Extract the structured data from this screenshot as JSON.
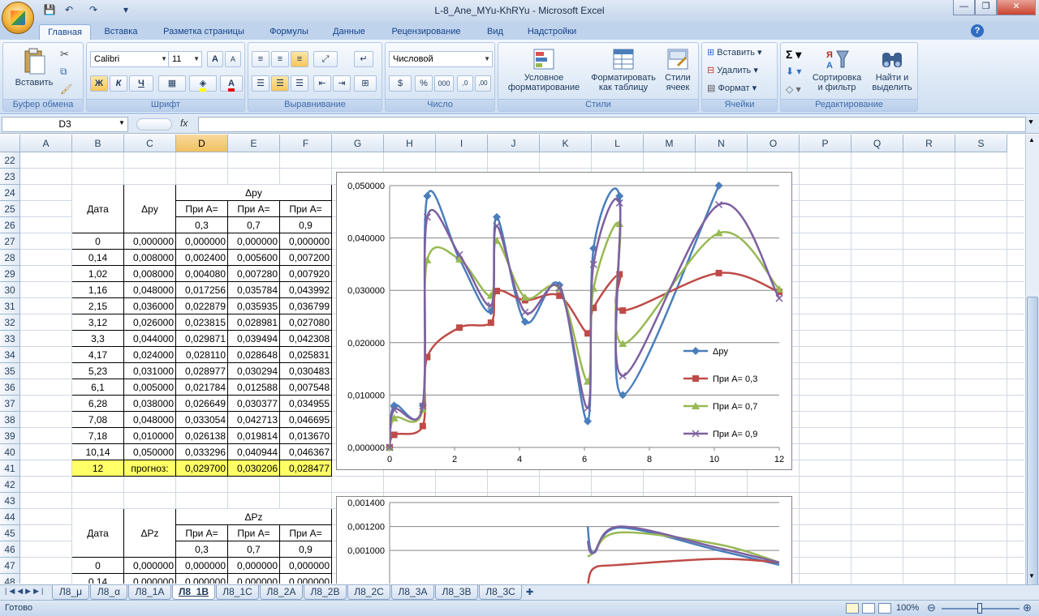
{
  "app": {
    "title": "L-8_Ane_MYu-KhRYu - Microsoft Excel",
    "minimize": "—",
    "restore": "❐",
    "close": "✕",
    "help": "?"
  },
  "quick_access": {
    "save": "💾",
    "undo": "↶",
    "redo": "↷",
    "customize": "▾"
  },
  "tabs": [
    "Главная",
    "Вставка",
    "Разметка страницы",
    "Формулы",
    "Данные",
    "Рецензирование",
    "Вид",
    "Надстройки"
  ],
  "ribbon": {
    "clipboard": {
      "label": "Буфер обмена",
      "paste": "Вставить"
    },
    "font": {
      "label": "Шрифт",
      "name": "Calibri",
      "size": "11",
      "bold": "Ж",
      "italic": "К",
      "underline": "Ч"
    },
    "alignment": {
      "label": "Выравнивание"
    },
    "number": {
      "label": "Число",
      "format": "Числовой"
    },
    "styles": {
      "label": "Стили",
      "cond_format_1": "Условное",
      "cond_format_2": "форматирование",
      "format_table_1": "Форматировать",
      "format_table_2": "как таблицу",
      "cell_styles_1": "Стили",
      "cell_styles_2": "ячеек"
    },
    "cells": {
      "label": "Ячейки",
      "insert": "Вставить",
      "delete": "Удалить",
      "format": "Формат"
    },
    "editing": {
      "label": "Редактирование",
      "sort_1": "Сортировка",
      "sort_2": "и фильтр",
      "find_1": "Найти и",
      "find_2": "выделить"
    }
  },
  "formula_bar": {
    "name_box": "D3",
    "fx": "fx",
    "value": ""
  },
  "columns": [
    "A",
    "B",
    "C",
    "D",
    "E",
    "F",
    "G",
    "H",
    "I",
    "J",
    "K",
    "L",
    "M",
    "N",
    "O",
    "P",
    "Q",
    "R",
    "S"
  ],
  "selected_column": "D",
  "rows": [
    "22",
    "23",
    "24",
    "25",
    "26",
    "27",
    "28",
    "29",
    "30",
    "31",
    "32",
    "33",
    "34",
    "35",
    "36",
    "37",
    "38",
    "39",
    "40",
    "41",
    "42",
    "43",
    "44",
    "45",
    "46",
    "47",
    "48"
  ],
  "table1": {
    "h_date": "Дата",
    "h_dpy": "Δpy",
    "h_group": "Δpy",
    "h_a1": "При А=",
    "h_a2": "При А=",
    "h_a3": "При А=",
    "h_v1": "0,3",
    "h_v2": "0,7",
    "h_v3": "0,9",
    "rows": [
      [
        "0",
        "0,000000",
        "0,000000",
        "0,000000",
        "0,000000"
      ],
      [
        "0,14",
        "0,008000",
        "0,002400",
        "0,005600",
        "0,007200"
      ],
      [
        "1,02",
        "0,008000",
        "0,004080",
        "0,007280",
        "0,007920"
      ],
      [
        "1,16",
        "0,048000",
        "0,017256",
        "0,035784",
        "0,043992"
      ],
      [
        "2,15",
        "0,036000",
        "0,022879",
        "0,035935",
        "0,036799"
      ],
      [
        "3,12",
        "0,026000",
        "0,023815",
        "0,028981",
        "0,027080"
      ],
      [
        "3,3",
        "0,044000",
        "0,029871",
        "0,039494",
        "0,042308"
      ],
      [
        "4,17",
        "0,024000",
        "0,028110",
        "0,028648",
        "0,025831"
      ],
      [
        "5,23",
        "0,031000",
        "0,028977",
        "0,030294",
        "0,030483"
      ],
      [
        "6,1",
        "0,005000",
        "0,021784",
        "0,012588",
        "0,007548"
      ],
      [
        "6,28",
        "0,038000",
        "0,026649",
        "0,030377",
        "0,034955"
      ],
      [
        "7,08",
        "0,048000",
        "0,033054",
        "0,042713",
        "0,046695"
      ],
      [
        "7,18",
        "0,010000",
        "0,026138",
        "0,019814",
        "0,013670"
      ],
      [
        "10,14",
        "0,050000",
        "0,033296",
        "0,040944",
        "0,046367"
      ]
    ],
    "forecast": [
      "12",
      "прогноз:",
      "0,029700",
      "0,030206",
      "0,028477"
    ]
  },
  "table2": {
    "h_date": "Дата",
    "h_dpz": "ΔPz",
    "h_group": "ΔPz",
    "h_a1": "При А=",
    "h_a2": "При А=",
    "h_a3": "При А=",
    "h_v1": "0,3",
    "h_v2": "0,7",
    "h_v3": "0,9",
    "rows": [
      [
        "0",
        "0,000000",
        "0,000000",
        "0,000000",
        "0,000000"
      ],
      [
        "0,14",
        "0,000000",
        "0,000000",
        "0,000000",
        "0,000000"
      ]
    ]
  },
  "chart_data": [
    {
      "type": "line",
      "x": [
        0,
        0.14,
        1.02,
        1.16,
        2.15,
        3.12,
        3.3,
        4.17,
        5.23,
        6.1,
        6.28,
        7.08,
        7.18,
        10.14,
        12
      ],
      "series": [
        {
          "name": "Δpy",
          "color": "#4a7ebb",
          "marker": "diamond",
          "values": [
            0,
            0.008,
            0.008,
            0.048,
            0.036,
            0.026,
            0.044,
            0.024,
            0.031,
            0.005,
            0.038,
            0.048,
            0.01,
            0.05,
            null
          ]
        },
        {
          "name": "При А= 0,3",
          "color": "#be4b48",
          "marker": "square",
          "values": [
            0,
            0.0024,
            0.00408,
            0.017256,
            0.022879,
            0.023815,
            0.029871,
            0.02811,
            0.028977,
            0.021784,
            0.026649,
            0.033054,
            0.026138,
            0.033296,
            0.0297
          ]
        },
        {
          "name": "При А= 0,7",
          "color": "#98b954",
          "marker": "triangle",
          "values": [
            0,
            0.0056,
            0.00728,
            0.035784,
            0.035935,
            0.028981,
            0.039494,
            0.028648,
            0.030294,
            0.012588,
            0.030377,
            0.042713,
            0.019814,
            0.040944,
            0.030206
          ]
        },
        {
          "name": "При А= 0,9",
          "color": "#7d60a0",
          "marker": "x",
          "values": [
            0,
            0.0072,
            0.00792,
            0.043992,
            0.036799,
            0.02708,
            0.042308,
            0.025831,
            0.030483,
            0.007548,
            0.034955,
            0.046695,
            0.01367,
            0.046367,
            0.028477
          ]
        }
      ],
      "xlim": [
        0,
        12
      ],
      "ylim": [
        0,
        0.05
      ],
      "x_ticks": [
        "0",
        "2",
        "4",
        "6",
        "8",
        "10",
        "12"
      ],
      "y_ticks": [
        "0,000000",
        "0,010000",
        "0,020000",
        "0,030000",
        "0,040000",
        "0,050000"
      ],
      "legend": "right",
      "grid": "horizontal"
    },
    {
      "type": "line",
      "x": [
        6.1,
        6.28,
        7.08,
        10.14,
        12
      ],
      "series": [
        {
          "name": "Δpy",
          "color": "#4a7ebb",
          "values": [
            0.0012,
            0.00098,
            0.00119,
            0.001,
            0.00088
          ]
        },
        {
          "name": "При А= 0,3",
          "color": "#be4b48",
          "values": [
            0.0007,
            0.00085,
            0.00088,
            0.00093,
            0.0009
          ]
        },
        {
          "name": "При А= 0,7",
          "color": "#98b954",
          "values": [
            0.00095,
            0.00098,
            0.00115,
            0.00105,
            0.0009
          ]
        },
        {
          "name": "При А= 0,9",
          "color": "#7d60a0",
          "values": [
            0.00108,
            0.00098,
            0.0012,
            0.00102,
            0.0009
          ]
        }
      ],
      "xlim": [
        0,
        12
      ],
      "ylim": [
        0,
        0.0014
      ],
      "y_ticks": [
        "0,001000",
        "0,001200",
        "0,001400"
      ]
    }
  ],
  "sheets": [
    "Л8_μ",
    "Л8_α",
    "Л8_1А",
    "Л8_1В",
    "Л8_1С",
    "Л8_2А",
    "Л8_2В",
    "Л8_2С",
    "Л8_3А",
    "Л8_3В",
    "Л8_3С"
  ],
  "active_sheet": "Л8_1В",
  "status": {
    "ready": "Готово",
    "zoom": "100%"
  }
}
